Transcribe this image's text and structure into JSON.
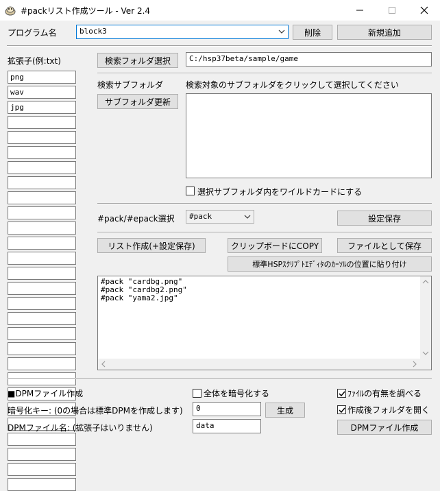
{
  "window": {
    "title": "#packリスト作成ツール - Ver 2.4"
  },
  "program": {
    "label": "プログラム名",
    "selected": "block3",
    "delete_label": "削除",
    "new_label": "新規追加"
  },
  "extensions": {
    "label": "拡張子(例:txt)",
    "items": [
      "png",
      "wav",
      "jpg",
      "",
      "",
      "",
      "",
      "",
      "",
      "",
      "",
      "",
      "",
      "",
      "",
      "",
      "",
      "",
      "",
      "",
      "",
      "",
      "",
      "",
      "",
      "",
      "",
      ""
    ]
  },
  "search": {
    "folder_button": "検索フォルダ選択",
    "folder_path": "C:/hsp37beta/sample/game",
    "subfolder_label": "検索サブフォルダ",
    "subfolder_hint": "検索対象のサブフォルダをクリックして選択してください",
    "update_button": "サブフォルダ更新",
    "wildcard_label": "選択サブフォルダ内をワイルドカードにする",
    "wildcard_checked": false
  },
  "pack": {
    "label": "#pack/#epack選択",
    "selected": "#pack",
    "save_settings": "設定保存"
  },
  "actions": {
    "make_list": "リスト作成(+設定保存)",
    "copy_clipboard": "クリップボードにCOPY",
    "save_file": "ファイルとして保存",
    "paste_editor": "標準HSPｽｸﾘﾌﾟﾄｴﾃﾞｨﾀのｶｰｿﾙの位置に貼り付け"
  },
  "output": {
    "lines": [
      "#pack \"cardbg.png\"",
      "#pack \"cardbg2.png\"",
      "#pack \"yama2.jpg\""
    ]
  },
  "dpm": {
    "section_label": "■DPMファイル作成",
    "encrypt_all_label": "全体を暗号化する",
    "encrypt_all_checked": false,
    "check_exists_label": "ﾌｧｲﾙの有無を調べる",
    "check_exists_checked": true,
    "key_label": "暗号化キー: (0の場合は標準DPMを作成します)",
    "key_value": "0",
    "generate_button": "生成",
    "open_folder_label": "作成後フォルダを開く",
    "open_folder_checked": true,
    "filename_label": "DPMファイル名: (拡張子はいりません)",
    "filename_value": "data",
    "create_button": "DPMファイル作成"
  }
}
